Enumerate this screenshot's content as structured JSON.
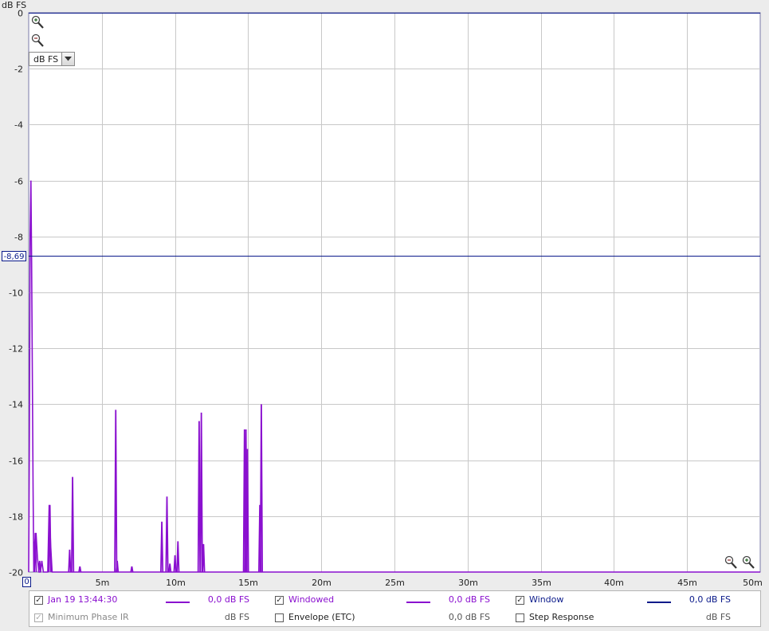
{
  "y_unit": "dB FS",
  "units_select": {
    "value": "dB FS"
  },
  "cursor_value": "-8,69",
  "x_origin_label": "0",
  "colors": {
    "trace": "#8a10cf",
    "window": "#0a1a8a",
    "grid": "#c8c8c8",
    "plot_bg": "#ffffff"
  },
  "chart_data": {
    "type": "line",
    "title": "",
    "xlabel": "",
    "ylabel": "dB FS",
    "xlim": [
      0,
      50
    ],
    "ylim": [
      -20,
      0
    ],
    "x_ticks": [
      "5m",
      "10m",
      "15m",
      "20m",
      "25m",
      "30m",
      "35m",
      "40m",
      "45m",
      "50m"
    ],
    "x_tick_values": [
      5,
      10,
      15,
      20,
      25,
      30,
      35,
      40,
      45,
      50
    ],
    "y_ticks": [
      "0",
      "-2",
      "-4",
      "-6",
      "-8",
      "-10",
      "-12",
      "-14",
      "-16",
      "-18",
      "-20"
    ],
    "y_tick_values": [
      0,
      -2,
      -4,
      -6,
      -8,
      -10,
      -12,
      -14,
      -16,
      -18,
      -20
    ],
    "grid": true,
    "cursor_line": {
      "y": -8.69
    },
    "series": [
      {
        "name": "Windowed",
        "x": [
          0.0,
          0.05,
          0.1,
          0.15,
          0.2,
          0.3,
          0.35,
          0.4,
          0.5,
          0.6,
          0.7,
          0.75,
          0.8,
          0.85,
          0.9,
          1.0,
          1.3,
          1.4,
          1.5,
          1.6,
          2.0,
          2.05,
          2.1,
          2.2,
          2.3,
          2.5,
          2.55,
          2.6,
          3.0,
          3.3,
          3.4,
          3.5,
          3.6,
          3.7,
          4.1,
          4.15,
          4.2,
          4.3,
          4.45,
          4.5,
          4.55,
          4.65,
          4.7,
          4.75,
          4.8,
          5.0,
          5.3,
          5.35,
          5.4,
          5.5,
          5.9,
          6.0,
          6.05,
          6.1,
          6.15,
          6.2,
          6.3,
          6.35,
          6.4,
          7.0,
          7.1,
          7.15,
          7.2,
          7.3,
          9.0,
          9.1,
          9.15,
          9.2,
          9.3,
          9.4,
          9.55,
          9.6,
          9.65,
          9.7,
          9.9,
          10.0,
          10.05,
          10.1,
          10.2,
          10.25,
          10.3,
          10.35,
          10.4,
          11.0,
          11.6,
          11.65,
          11.7,
          11.75,
          11.8,
          11.85,
          11.9,
          11.95,
          12.0,
          12.1,
          13.0,
          14.6,
          14.65,
          14.7,
          14.75,
          14.8,
          14.85,
          14.9,
          14.95,
          15.0,
          15.1,
          15.5,
          15.75,
          15.8,
          15.85,
          15.9,
          15.95,
          16.0,
          16.1,
          20.0,
          50.0
        ],
        "y": [
          -20.0,
          -15.0,
          -8.0,
          -6.0,
          -9.0,
          -17.0,
          -20.0,
          -19.0,
          -18.6,
          -19.5,
          -20.0,
          -20.0,
          -20.0,
          -19.8,
          -19.6,
          -20.0,
          -20.0,
          -17.6,
          -19.0,
          -20.0,
          -20.0,
          -20.0,
          -20.0,
          -20.0,
          -20.0,
          -20.0,
          -20.0,
          -20.0,
          -20.0,
          -20.0,
          -20.0,
          -20.0,
          -20.0,
          -20.0,
          -20.0,
          -20.0,
          -20.0,
          -20.0,
          -20.0,
          -20.0,
          -20.0,
          -20.0,
          -20.0,
          -20.0,
          -20.0,
          -20.0,
          -20.0,
          -20.0,
          -20.0,
          -20.0,
          -20.0,
          -20.0,
          -20.0,
          -20.0,
          -20.0,
          -20.0,
          -20.0,
          -20.0,
          -20.0,
          -20.0,
          -20.0,
          -20.0,
          -20.0,
          -20.0,
          -20.0,
          -20.0,
          -20.0,
          -20.0,
          -20.0,
          -20.0,
          -20.0,
          -20.0,
          -20.0,
          -20.0,
          -20.0,
          -20.0,
          -20.0,
          -20.0,
          -20.0,
          -20.0,
          -20.0,
          -20.0,
          -20.0,
          -20.0,
          -20.0,
          -20.0,
          -20.0,
          -20.0,
          -20.0,
          -20.0,
          -20.0,
          -20.0,
          -20.0,
          -20.0,
          -20.0,
          -20.0,
          -20.0,
          -20.0,
          -20.0,
          -20.0,
          -20.0,
          -20.0,
          -20.0,
          -20.0,
          -20.0,
          -20.0,
          -20.0,
          -20.0,
          -20.0,
          -20.0,
          -20.0,
          -20.0,
          -20.0,
          -20.0,
          -20.0
        ]
      }
    ],
    "spikes": [
      {
        "x": 0.45,
        "y": -18.6
      },
      {
        "x": 0.75,
        "y": -19.6
      },
      {
        "x": 1.45,
        "y": -17.6
      },
      {
        "x": 2.8,
        "y": -19.2
      },
      {
        "x": 3.0,
        "y": -16.6
      },
      {
        "x": 3.5,
        "y": -19.8
      },
      {
        "x": 5.95,
        "y": -14.2
      },
      {
        "x": 6.05,
        "y": -19.6
      },
      {
        "x": 7.05,
        "y": -19.8
      },
      {
        "x": 9.1,
        "y": -18.2
      },
      {
        "x": 9.45,
        "y": -17.3
      },
      {
        "x": 9.65,
        "y": -19.7
      },
      {
        "x": 10.0,
        "y": -19.4
      },
      {
        "x": 10.2,
        "y": -18.9
      },
      {
        "x": 11.65,
        "y": -14.6
      },
      {
        "x": 11.8,
        "y": -14.3
      },
      {
        "x": 11.95,
        "y": -19.0
      },
      {
        "x": 14.75,
        "y": -14.9
      },
      {
        "x": 14.85,
        "y": -14.9
      },
      {
        "x": 14.95,
        "y": -15.6
      },
      {
        "x": 15.8,
        "y": -17.6
      },
      {
        "x": 15.9,
        "y": -14.0
      }
    ],
    "legend_position": "bottom"
  },
  "legend": [
    {
      "label": "Jan 19 13:44:30",
      "checked": true,
      "enabled": true,
      "value": "0,0 dB FS",
      "swatch": "#8a10cf"
    },
    {
      "label": "Windowed",
      "checked": true,
      "enabled": true,
      "value": "0,0 dB FS",
      "swatch": "#8a10cf"
    },
    {
      "label": "Window",
      "checked": true,
      "enabled": true,
      "value": "0,0 dB FS",
      "swatch": "#0a1a8a"
    },
    {
      "label": "Minimum Phase IR",
      "checked": true,
      "enabled": false,
      "value": "dB FS",
      "swatch": ""
    },
    {
      "label": "Envelope (ETC)",
      "checked": false,
      "enabled": true,
      "value": "0,0 dB FS",
      "swatch": ""
    },
    {
      "label": "Step Response",
      "checked": false,
      "enabled": true,
      "value": "dB FS",
      "swatch": ""
    }
  ]
}
